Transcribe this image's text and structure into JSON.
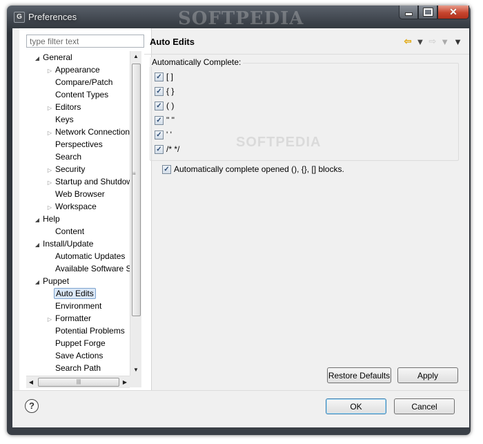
{
  "window": {
    "title": "Preferences",
    "app_icon": "G",
    "watermark": "SOFTPEDIA",
    "buttons": [
      "minimize-icon",
      "maximize-icon",
      "close-icon"
    ]
  },
  "sidebar": {
    "filter_placeholder": "type filter text",
    "tree": [
      {
        "label": "General",
        "level": 0,
        "twisty": "open"
      },
      {
        "label": "Appearance",
        "level": 1,
        "twisty": "closed"
      },
      {
        "label": "Compare/Patch",
        "level": 1,
        "twisty": ""
      },
      {
        "label": "Content Types",
        "level": 1,
        "twisty": ""
      },
      {
        "label": "Editors",
        "level": 1,
        "twisty": "closed"
      },
      {
        "label": "Keys",
        "level": 1,
        "twisty": ""
      },
      {
        "label": "Network Connections",
        "level": 1,
        "twisty": "closed"
      },
      {
        "label": "Perspectives",
        "level": 1,
        "twisty": ""
      },
      {
        "label": "Search",
        "level": 1,
        "twisty": ""
      },
      {
        "label": "Security",
        "level": 1,
        "twisty": "closed"
      },
      {
        "label": "Startup and Shutdown",
        "level": 1,
        "twisty": "closed"
      },
      {
        "label": "Web Browser",
        "level": 1,
        "twisty": ""
      },
      {
        "label": "Workspace",
        "level": 1,
        "twisty": "closed"
      },
      {
        "label": "Help",
        "level": 0,
        "twisty": "open"
      },
      {
        "label": "Content",
        "level": 1,
        "twisty": ""
      },
      {
        "label": "Install/Update",
        "level": 0,
        "twisty": "open"
      },
      {
        "label": "Automatic Updates",
        "level": 1,
        "twisty": ""
      },
      {
        "label": "Available Software Sites",
        "level": 1,
        "twisty": ""
      },
      {
        "label": "Puppet",
        "level": 0,
        "twisty": "open"
      },
      {
        "label": "Auto Edits",
        "level": 1,
        "twisty": "",
        "selected": true
      },
      {
        "label": "Environment",
        "level": 1,
        "twisty": ""
      },
      {
        "label": "Formatter",
        "level": 1,
        "twisty": "closed"
      },
      {
        "label": "Potential Problems",
        "level": 1,
        "twisty": ""
      },
      {
        "label": "Puppet Forge",
        "level": 1,
        "twisty": ""
      },
      {
        "label": "Save Actions",
        "level": 1,
        "twisty": ""
      },
      {
        "label": "Search Path",
        "level": 1,
        "twisty": ""
      }
    ]
  },
  "page": {
    "title": "Auto Edits",
    "nav_icons": [
      "back-arrow-icon",
      "forward-arrow-icon",
      "view-menu-icon"
    ],
    "group_label": "Automatically Complete:",
    "complete_items": [
      {
        "label": "[ ]",
        "checked": true
      },
      {
        "label": "{ }",
        "checked": true
      },
      {
        "label": "( )",
        "checked": true
      },
      {
        "label": "\" \"",
        "checked": true
      },
      {
        "label": "' '",
        "checked": true
      },
      {
        "label": "/* */",
        "checked": true
      }
    ],
    "blocks_option": {
      "label": "Automatically complete opened (), {}, [] blocks.",
      "checked": true
    },
    "watermark": "SOFTPEDIA"
  },
  "actions": {
    "restore_defaults": "Restore Defaults",
    "apply": "Apply",
    "ok": "OK",
    "cancel": "Cancel",
    "help": "?"
  }
}
